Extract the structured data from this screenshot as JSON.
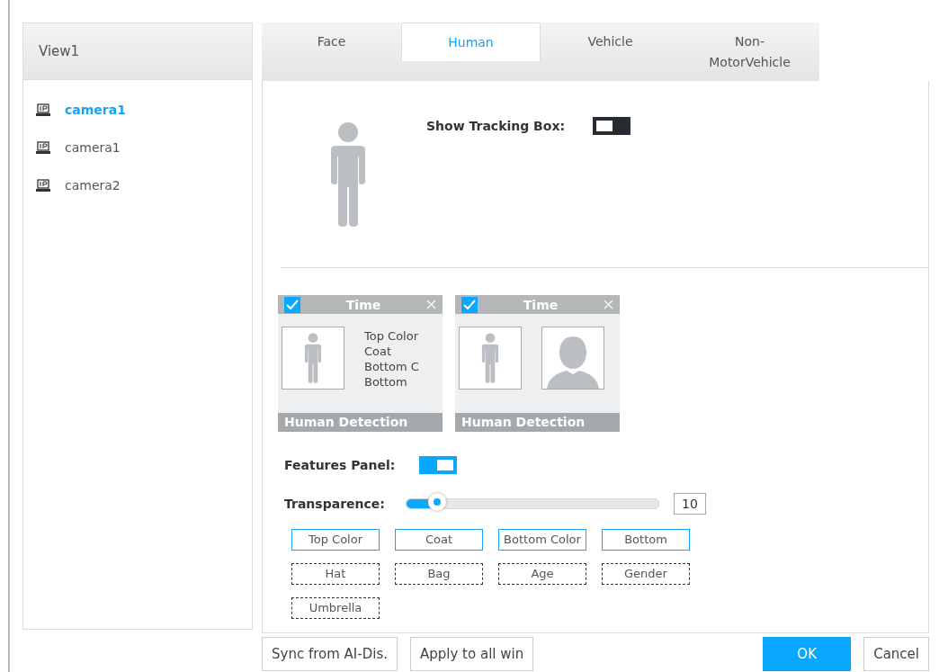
{
  "sidebar": {
    "title": "View1",
    "items": [
      {
        "label": "camera1",
        "selected": true
      },
      {
        "label": "camera1",
        "selected": false
      },
      {
        "label": "camera2",
        "selected": false
      }
    ]
  },
  "tabs": [
    {
      "label": "Face",
      "selected": false
    },
    {
      "label": "Human",
      "selected": true
    },
    {
      "label": "Vehicle",
      "selected": false
    },
    {
      "label": "Non-\nMotorVehicle",
      "selected": false
    }
  ],
  "show_tracking_box": {
    "label": "Show Tracking Box:",
    "on": false
  },
  "cards": [
    {
      "kind": "text",
      "checked": true,
      "time": "Time",
      "lines": [
        "Top Color",
        "Coat",
        "Bottom C",
        "Bottom"
      ],
      "footer": "Human Detection"
    },
    {
      "kind": "face",
      "checked": true,
      "time": "Time",
      "footer": "Human Detection"
    }
  ],
  "features_panel": {
    "label": "Features Panel:",
    "on": true
  },
  "transparence": {
    "label": "Transparence:",
    "level": 0.12,
    "reading": "10"
  },
  "features": [
    {
      "label": "Top Color",
      "selected": true
    },
    {
      "label": "Coat",
      "selected": true
    },
    {
      "label": "Bottom Color",
      "selected": true
    },
    {
      "label": "Bottom",
      "selected": true
    },
    {
      "label": "Hat",
      "selected": false
    },
    {
      "label": "Bag",
      "selected": false
    },
    {
      "label": "Age",
      "selected": false
    },
    {
      "label": "Gender",
      "selected": false
    },
    {
      "label": "Umbrella",
      "selected": false
    }
  ],
  "buttons": {
    "sync": "Sync from AI-Dis.",
    "apply": "Apply to all win",
    "ok": "OK",
    "cancel": "Cancel"
  }
}
